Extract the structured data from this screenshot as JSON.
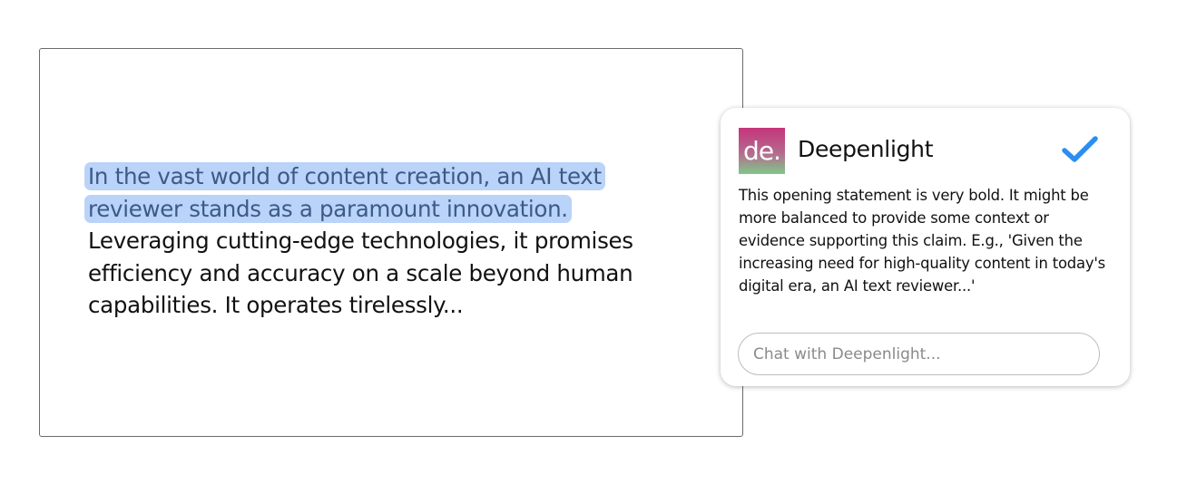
{
  "editor": {
    "highlighted_line_1": "In the vast world of content creation, an AI text",
    "highlighted_line_2": "reviewer stands as a paramount innovation.",
    "rest_text": "Leveraging cutting-edge technologies, it promises efficiency and accuracy on a scale beyond human capabilities. It operates tirelessly..."
  },
  "card": {
    "logo_text": "de.",
    "title": "Deepenlight",
    "check_icon": "checkmark-icon",
    "comment": "This opening statement is very bold. It might be more balanced to provide some context or evidence supporting this claim. E.g., 'Given the increasing need for high-quality content in today's digital era, an AI text reviewer...'",
    "chat_placeholder": "Chat with Deepenlight..."
  },
  "colors": {
    "highlight_bg": "#b9d3f9",
    "highlight_text": "#3d5a86",
    "accent_check": "#2a8ff0"
  }
}
